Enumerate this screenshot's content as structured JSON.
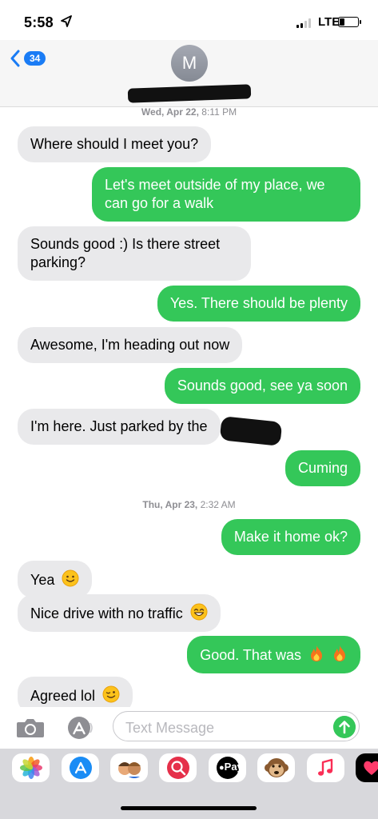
{
  "status_bar": {
    "time": "5:58",
    "network": "LTE",
    "battery_level": 0.3,
    "signal_bars_active": 2,
    "signal_bars_total": 4
  },
  "header": {
    "back_badge": "34",
    "avatar_initial": "M"
  },
  "thread": {
    "timestamps": [
      {
        "day": "Wed, Apr 22,",
        "time": "8:11 PM"
      },
      {
        "day": "Thu, Apr 23,",
        "time": "2:32 AM"
      }
    ],
    "messages": [
      {
        "from": "received",
        "text": "Where should I meet you?"
      },
      {
        "from": "sent",
        "text": "Let's meet outside of my place, we can go for a walk"
      },
      {
        "from": "received",
        "text": "Sounds good :) Is there street parking?"
      },
      {
        "from": "sent",
        "text": "Yes. There should be plenty"
      },
      {
        "from": "received",
        "text": "Awesome, I'm heading out now"
      },
      {
        "from": "sent",
        "text": "Sounds good, see ya soon"
      },
      {
        "from": "received",
        "text": "I'm here. Just parked by the"
      },
      {
        "from": "sent",
        "text": "Cuming"
      },
      {
        "from": "sent",
        "text": "Make it home ok?"
      },
      {
        "from": "received",
        "text": "Yea"
      },
      {
        "from": "received",
        "text": "Nice drive with no traffic"
      },
      {
        "from": "sent",
        "text": "Good. That was"
      },
      {
        "from": "received",
        "text": "Agreed lol"
      }
    ]
  },
  "input": {
    "placeholder": "Text Message"
  },
  "app_drawer": {
    "apps": [
      "Photos",
      "App Store",
      "Memoji Stickers",
      "Images",
      "Apple Pay",
      "Animoji",
      "Music",
      "Digital Touch"
    ],
    "apple_pay_label": "Pay"
  },
  "colors": {
    "sent_bubble": "#34c759",
    "received_bubble": "#e9e9eb",
    "accent": "#1a7cf5"
  }
}
